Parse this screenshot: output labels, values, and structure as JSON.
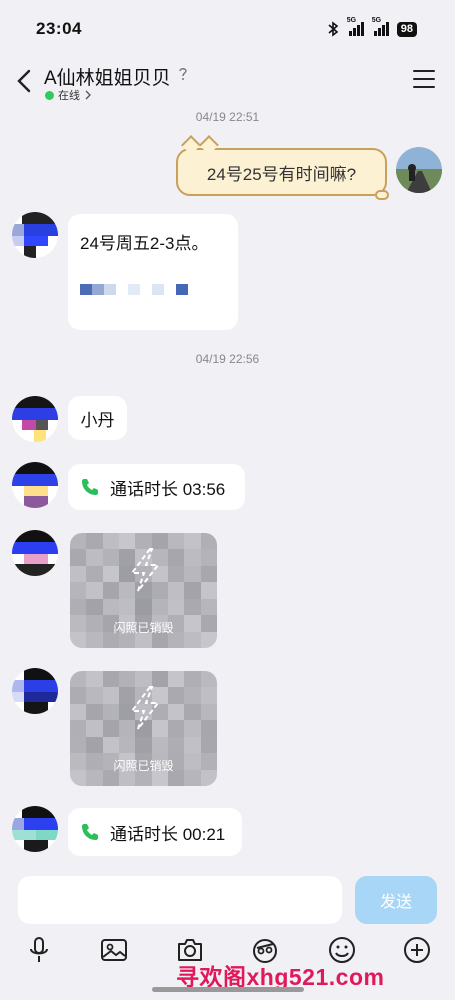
{
  "status": {
    "time": "23:04",
    "battery": "98",
    "signal_label": "5G"
  },
  "header": {
    "title": "A仙林姐姐贝贝",
    "online": "在线"
  },
  "timestamps": [
    "04/19 22:51",
    "04/19 22:56"
  ],
  "messages": {
    "outgoing_1": "24号25号有时间嘛?",
    "incoming_1": "24号周五2-3点。",
    "incoming_2": "小丹",
    "call_1": "通话时长 03:56",
    "flash_1": "闪照已销毁",
    "flash_2": "闪照已销毁",
    "call_2": "通话时长 00:21"
  },
  "input": {
    "placeholder": "",
    "send_label": "发送"
  },
  "toolbar": [
    "microphone-icon",
    "image-icon",
    "camera-icon",
    "red-packet-icon",
    "emoji-icon",
    "plus-icon"
  ],
  "watermark": "寻欢阁xhg521.com",
  "colors": {
    "online": "#2ecc5c",
    "send_button": "#a8d6f7",
    "watermark": "#e0195a",
    "phone": "#2bbf5a"
  }
}
